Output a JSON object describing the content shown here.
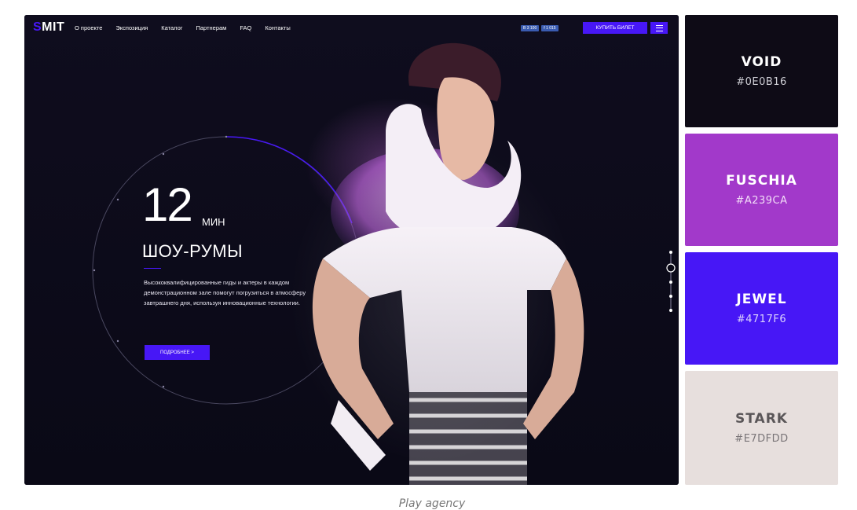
{
  "site": {
    "logo_accent": "S",
    "logo_rest": "MIT",
    "nav": [
      "О проекте",
      "Экспозиция",
      "Каталог",
      "Партнерам",
      "FAQ",
      "Контакты"
    ],
    "social_counts": [
      "В 3 100",
      "f 1 015"
    ],
    "buy_ticket": "КУПИТЬ БИЛЕТ",
    "hero": {
      "number": "12",
      "unit": "МИН",
      "title": "ШОУ-РУМЫ",
      "description": "Высококвалифицированные гиды и актеры в каждом демонстрационном зале помогут погрузиться в атмосферу завтрашнего дня, используя инновационные технологии.",
      "cta": "ПОДРОБНЕЕ  >"
    },
    "colors": {
      "accent": "#4717F6",
      "background": "#0a0916"
    }
  },
  "palette": [
    {
      "name": "VOID",
      "hex": "#0E0B16",
      "text_color": "#ffffff",
      "hex_color": "#cfcfd6"
    },
    {
      "name": "FUSCHIA",
      "hex": "#A239CA",
      "text_color": "#ffffff",
      "hex_color": "#f1dcf7"
    },
    {
      "name": "JEWEL",
      "hex": "#4717F6",
      "text_color": "#ffffff",
      "hex_color": "#ddd4fd"
    },
    {
      "name": "STARK",
      "hex": "#E7DFDD",
      "text_color": "#5a5658",
      "hex_color": "#7a7578"
    }
  ],
  "caption": "Play agency"
}
